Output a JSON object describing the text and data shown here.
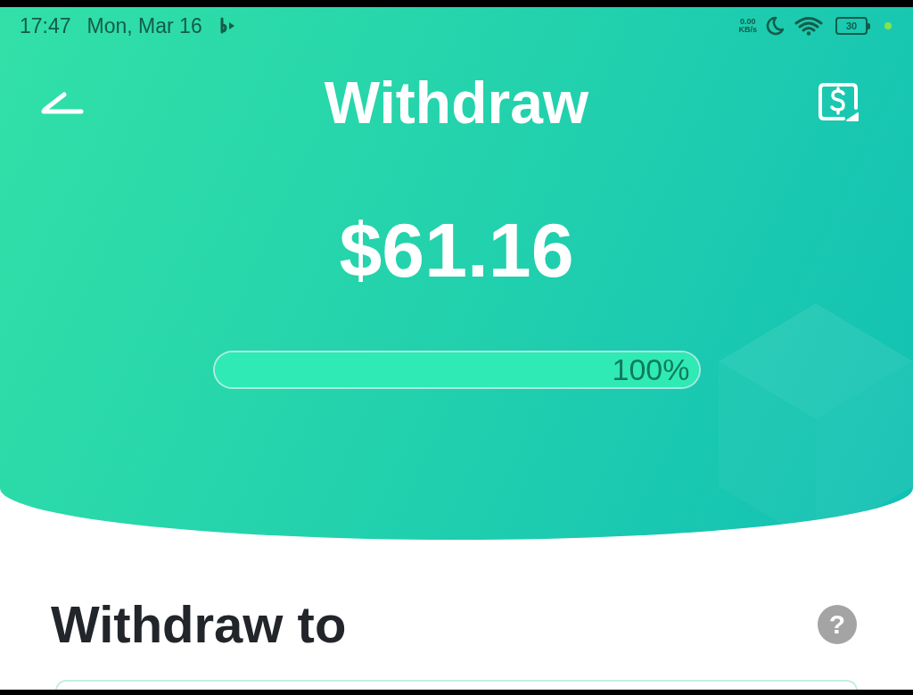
{
  "status_bar": {
    "time": "17:47",
    "date": "Mon, Mar 16",
    "network_speed": [
      "0.00",
      "KB/s"
    ],
    "battery": "30"
  },
  "header": {
    "title": "Withdraw",
    "balance": "$61.16",
    "progress": {
      "level": 1,
      "reading": "100%"
    }
  },
  "section": {
    "title": "Withdraw to",
    "help": "?"
  }
}
